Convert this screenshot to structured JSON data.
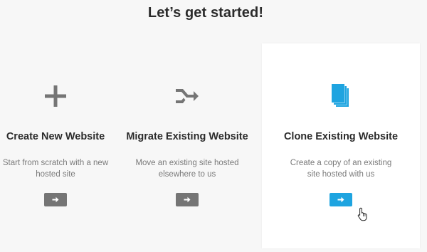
{
  "page": {
    "title": "Let’s get started!"
  },
  "options": [
    {
      "title": "Create New Website",
      "description": "Start from scratch with a new hosted site",
      "icon": "plus-icon",
      "button_icon": "arrow-right-icon",
      "button_color": "#757575"
    },
    {
      "title": "Migrate Existing Website",
      "description": "Move an existing site hosted elsewhere to us",
      "icon": "migrate-arrow-icon",
      "button_icon": "arrow-right-icon",
      "button_color": "#757575"
    },
    {
      "title": "Clone Existing Website",
      "description": "Create a copy of an existing site hosted with us",
      "icon": "copy-pages-icon",
      "button_icon": "arrow-right-icon",
      "button_color": "#1ea4e0",
      "highlighted": true
    }
  ],
  "colors": {
    "accent": "#1ea4e0",
    "icon_gray": "#757575",
    "card_highlight": "#ffffff"
  }
}
